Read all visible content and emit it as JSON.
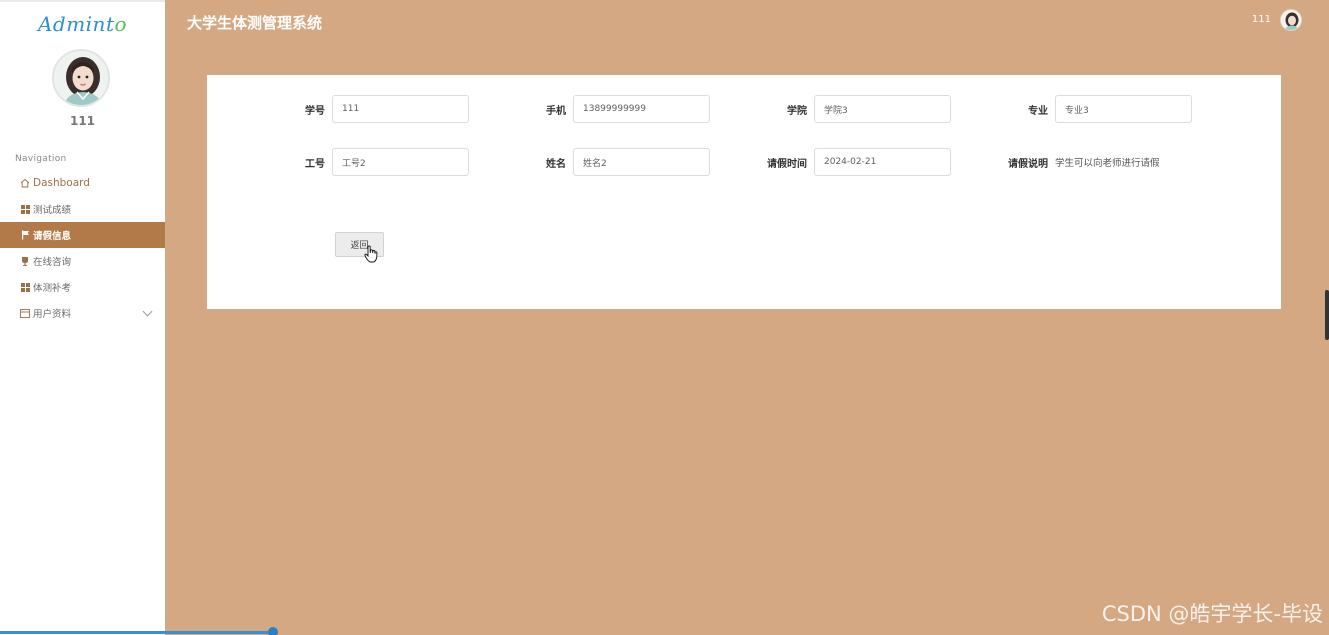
{
  "app": {
    "logo_main": "Admint",
    "logo_accent": "o",
    "title": "大学生体测管理系统",
    "header_username": "111"
  },
  "sidebar": {
    "username": "111",
    "nav_title": "Navigation",
    "items": [
      {
        "label": "Dashboard",
        "icon": "home-icon"
      },
      {
        "label": "测试成绩",
        "icon": "grid-icon"
      },
      {
        "label": "请假信息",
        "icon": "flag-icon",
        "active": true
      },
      {
        "label": "在线咨询",
        "icon": "cup-icon"
      },
      {
        "label": "体测补考",
        "icon": "grid-icon"
      },
      {
        "label": "用户资料",
        "icon": "card-icon",
        "expandable": true
      }
    ]
  },
  "form": {
    "xuehao": {
      "label": "学号",
      "value": "111"
    },
    "shouji": {
      "label": "手机",
      "value": "13899999999"
    },
    "xueyuan": {
      "label": "学院",
      "value": "学院3"
    },
    "zhuanye": {
      "label": "专业",
      "value": "专业3"
    },
    "gonghao": {
      "label": "工号",
      "value": "工号2"
    },
    "xingming": {
      "label": "姓名",
      "value": "姓名2"
    },
    "qingjia_time": {
      "label": "请假时间",
      "value": "2024-02-21"
    },
    "qingjia_desc": {
      "label": "请假说明",
      "value": "学生可以向老师进行请假"
    },
    "back_label": "返回"
  },
  "watermark": "CSDN @皓宇学长-毕设",
  "colors": {
    "background": "#d4a882",
    "active_nav": "#b27a48",
    "logo": "#2c8fd6"
  }
}
